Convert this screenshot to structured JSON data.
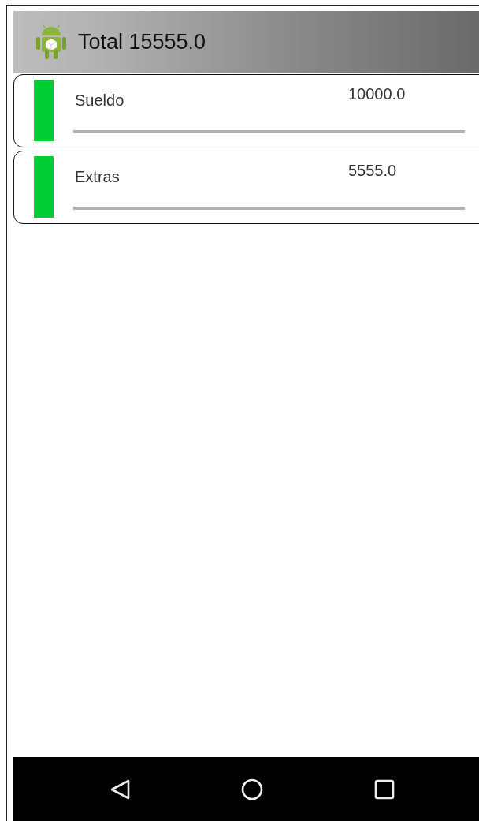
{
  "header": {
    "title": "Total 15555.0"
  },
  "entries": [
    {
      "name": "Sueldo",
      "amount": "10000.0",
      "color": "#00cc33"
    },
    {
      "name": "Extras",
      "amount": "5555.0",
      "color": "#00cc33"
    }
  ],
  "nav_bar": {
    "buttons": [
      {
        "kind": "back"
      },
      {
        "kind": "home"
      },
      {
        "kind": "recents"
      }
    ]
  }
}
